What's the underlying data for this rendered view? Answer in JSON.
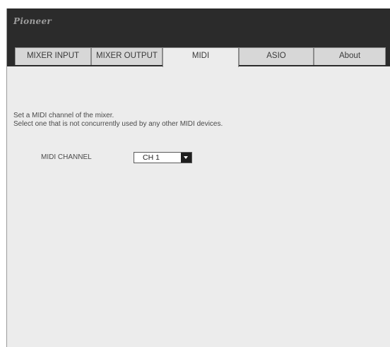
{
  "header": {
    "logo_text": "Pioneer"
  },
  "tabs": [
    {
      "label": "MIXER INPUT",
      "active": false
    },
    {
      "label": "MIXER OUTPUT",
      "active": false
    },
    {
      "label": "MIDI",
      "active": true
    },
    {
      "label": "ASIO",
      "active": false
    },
    {
      "label": "About",
      "active": false
    }
  ],
  "midi": {
    "description_line1": "Set a MIDI channel of the mixer.",
    "description_line2": "Select one that is not concurrently used by any other MIDI devices.",
    "channel_label": "MIDI CHANNEL",
    "channel_value": "CH 1"
  }
}
